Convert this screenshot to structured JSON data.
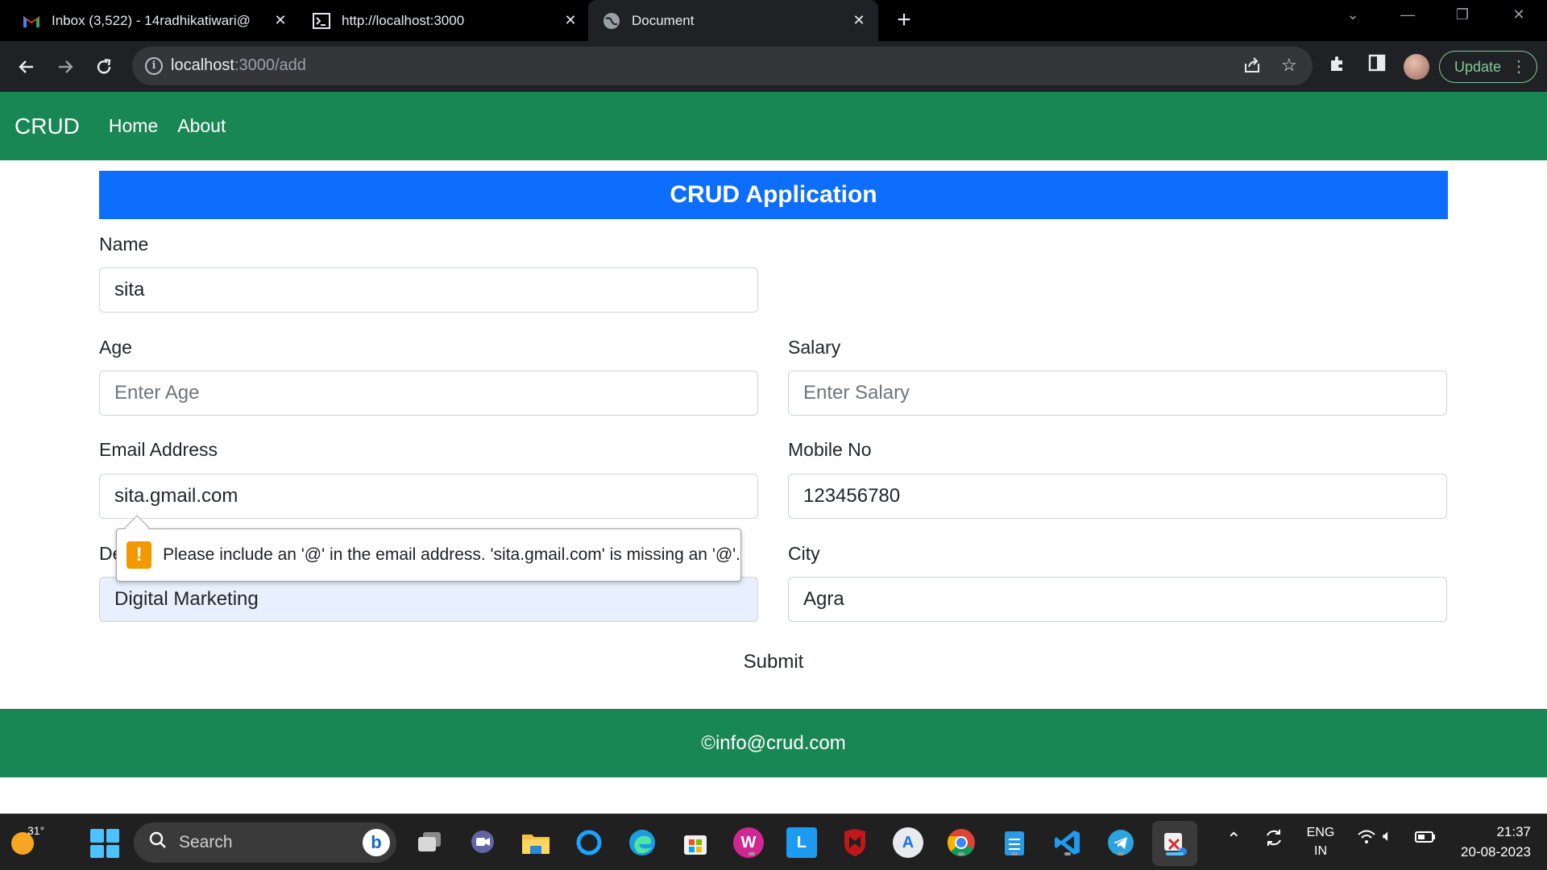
{
  "browser": {
    "tabs": [
      {
        "title": "Inbox (3,522) - 14radhikatiwari@",
        "icon": "gmail-icon"
      },
      {
        "title": "http://localhost:3000",
        "icon": "terminal-icon"
      },
      {
        "title": "Document",
        "icon": "globe-icon",
        "active": true
      }
    ],
    "url_host": "localhost",
    "url_rest": ":3000/add",
    "update_label": "Update"
  },
  "app": {
    "brand": "CRUD",
    "nav": [
      "Home",
      "About"
    ],
    "banner": "CRUD Application",
    "form": {
      "name_label": "Name",
      "name_value": "sita",
      "age_label": "Age",
      "age_placeholder": "Enter Age",
      "salary_label": "Salary",
      "salary_placeholder": "Enter Salary",
      "email_label": "Email Address",
      "email_value": "sita.gmail.com",
      "mobile_label": "Mobile No",
      "mobile_value": "123456780",
      "designation_label_visible": "De",
      "designation_value": "Digital Marketing",
      "city_label": "City",
      "city_value": "Agra",
      "submit_label": "Submit"
    },
    "validation_message": "Please include an '@' in the email address. 'sita.gmail.com' is missing an '@'.",
    "footer": "©info@crud.com"
  },
  "taskbar": {
    "weather_temp": "31°",
    "search_placeholder": "Search",
    "language_line1": "ENG",
    "language_line2": "IN",
    "time": "21:37",
    "date": "20-08-2023"
  },
  "colors": {
    "navbar_green": "#198754",
    "banner_blue": "#0d6efd",
    "warning_orange": "#f29900"
  }
}
